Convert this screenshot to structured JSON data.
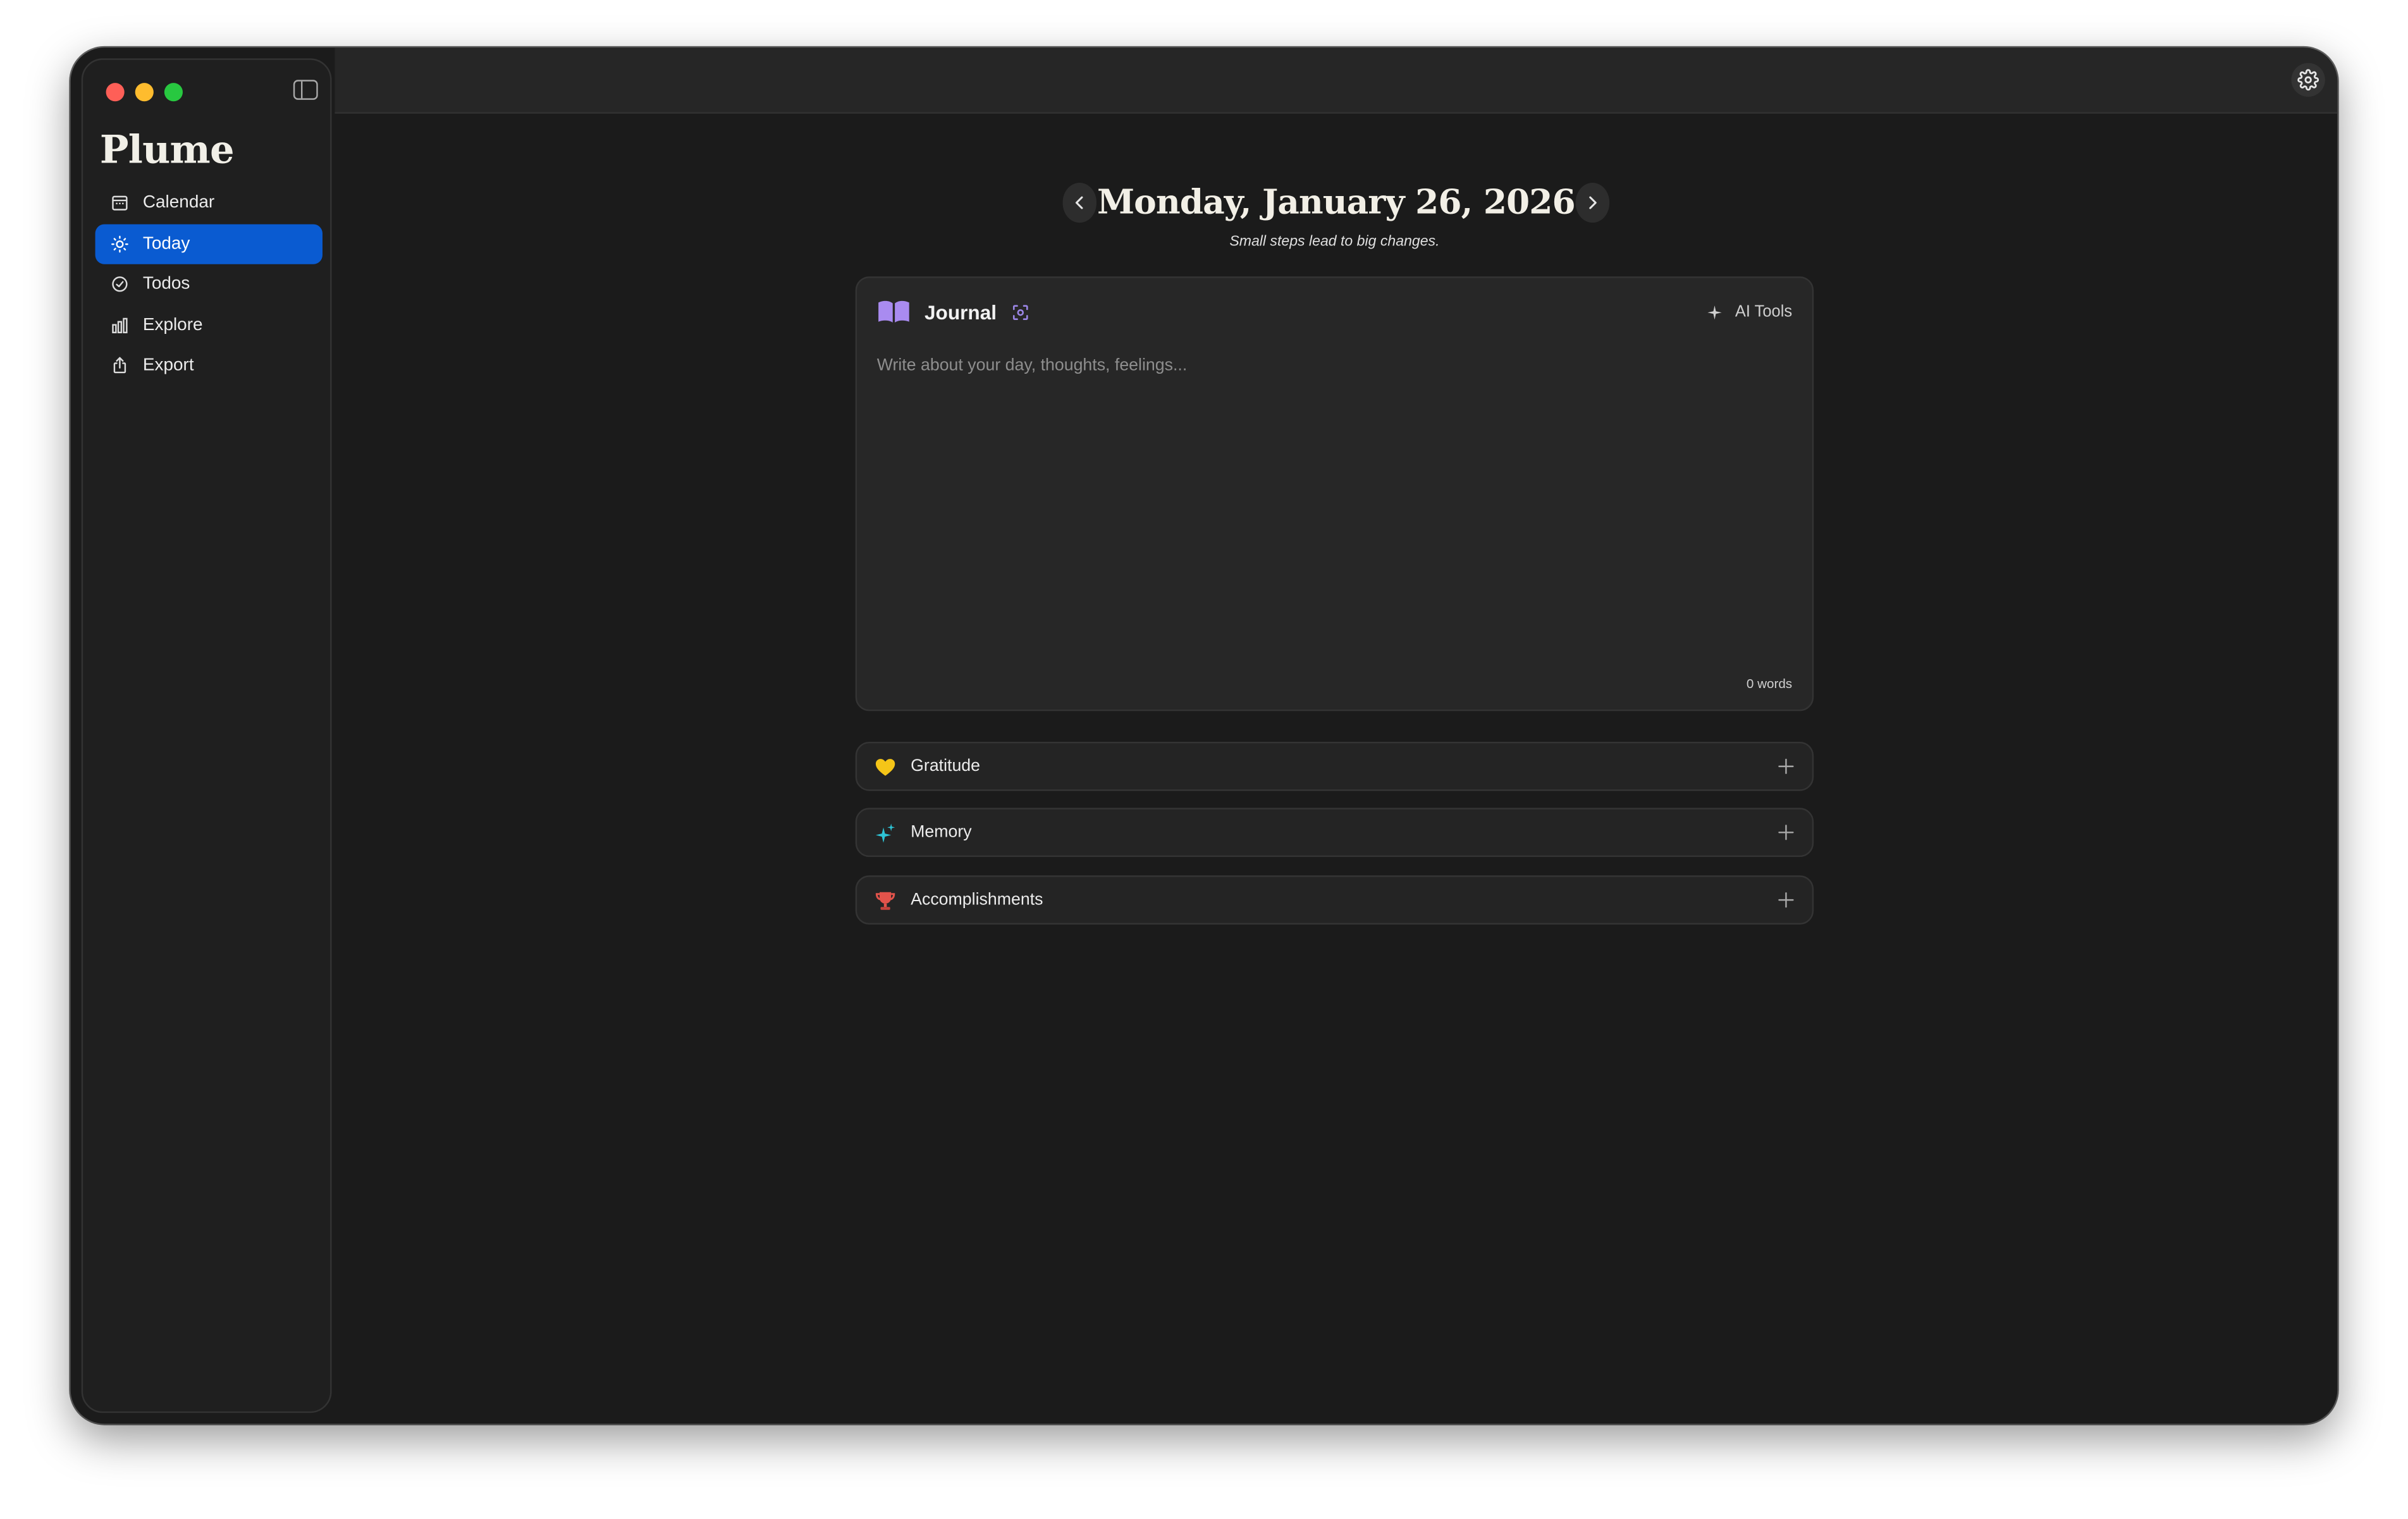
{
  "app": {
    "name": "Plume"
  },
  "sidebar": {
    "items": [
      {
        "label": "Calendar",
        "icon": "calendar-icon",
        "active": false
      },
      {
        "label": "Today",
        "icon": "sun-icon",
        "active": true
      },
      {
        "label": "Todos",
        "icon": "check-circle-icon",
        "active": false
      },
      {
        "label": "Explore",
        "icon": "bar-chart-icon",
        "active": false
      },
      {
        "label": "Export",
        "icon": "share-icon",
        "active": false
      }
    ]
  },
  "header": {
    "date": "Monday, January 26, 2026",
    "subtitle": "Small steps lead to big changes."
  },
  "journal": {
    "title": "Journal",
    "ai_tools_label": "AI Tools",
    "placeholder": "Write about your day, thoughts, feelings...",
    "word_count": "0 words"
  },
  "sections": [
    {
      "label": "Gratitude",
      "icon": "yellow-heart-icon"
    },
    {
      "label": "Memory",
      "icon": "sparkles-icon"
    },
    {
      "label": "Accomplishments",
      "icon": "trophy-icon"
    }
  ],
  "colors": {
    "accent": "#0a5bd1",
    "background": "#1b1b1b",
    "sidebar": "#1f1f1f",
    "journal_icon": "#a98bf0",
    "heart": "#f5c518",
    "sparkle": "#2ec4d6",
    "trophy": "#e2534b"
  }
}
